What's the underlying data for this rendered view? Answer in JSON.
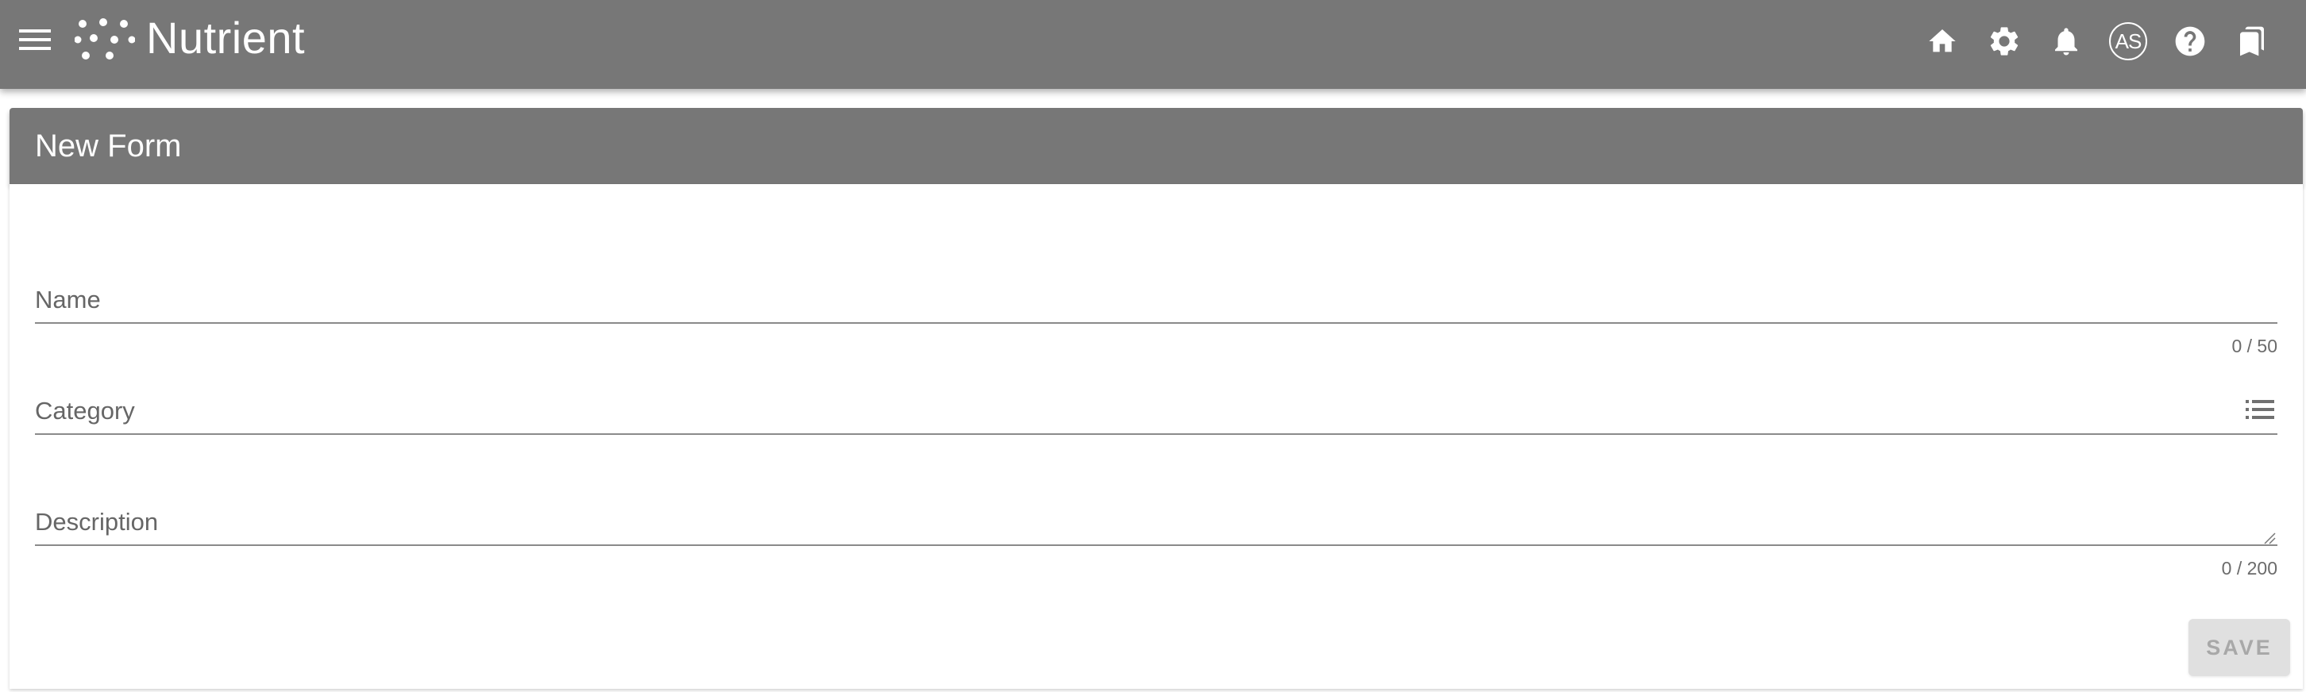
{
  "app": {
    "name": "Nutrient",
    "menu_icon": "hamburger-menu-icon",
    "logo_icon": "nutrient-dots-logo-icon",
    "toolbar_icons": [
      "home-icon",
      "settings-gear-icon",
      "notifications-bell-icon",
      "avatar",
      "help-icon",
      "bookmarks-icon"
    ],
    "user_initials": "AS"
  },
  "colors": {
    "header_bg": "#777777",
    "text_on_header": "#ffffff",
    "field_label": "#666666",
    "button_disabled_bg": "#e0e0e0",
    "button_disabled_text": "#a8a8a8"
  },
  "form": {
    "title": "New Form",
    "fields": {
      "name": {
        "label": "Name",
        "value": "",
        "counter": "0 / 50"
      },
      "category": {
        "label": "Category",
        "value": "",
        "icon": "list-icon"
      },
      "description": {
        "label": "Description",
        "value": "",
        "counter": "0 / 200"
      }
    },
    "save_label": "SAVE"
  }
}
